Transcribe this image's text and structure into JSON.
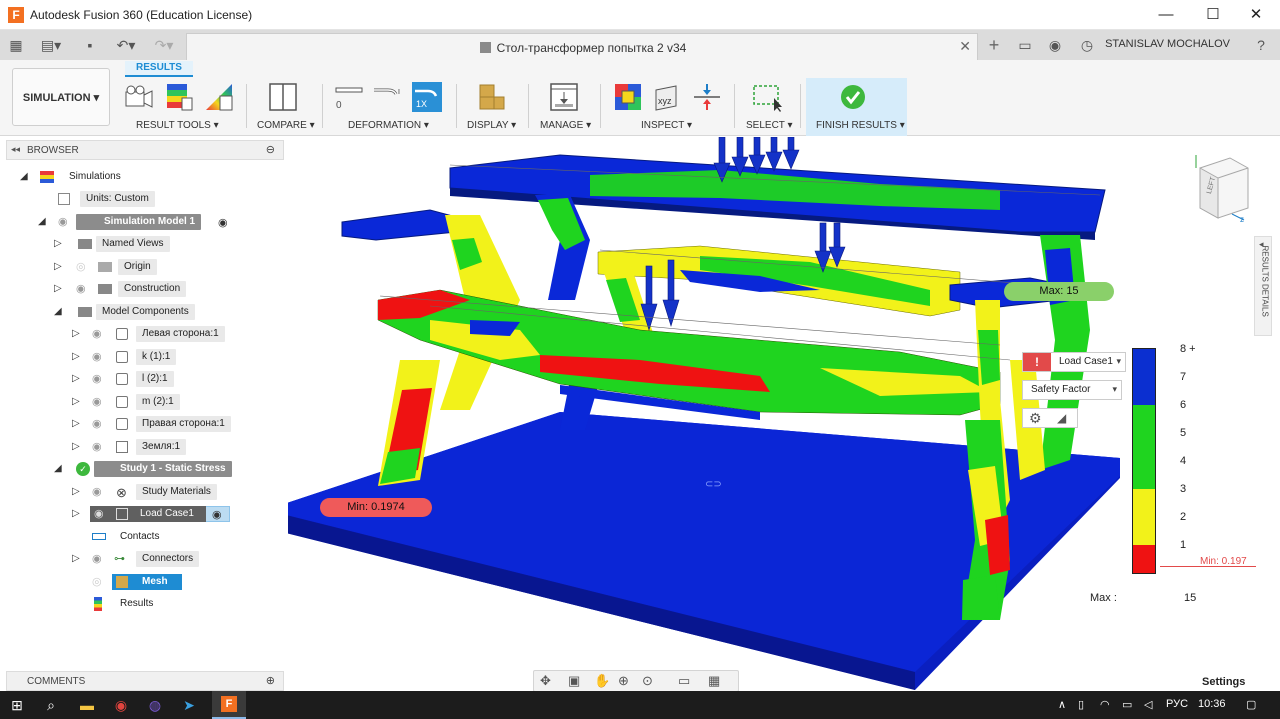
{
  "window": {
    "title": "Autodesk Fusion 360 (Education License)",
    "logo": "F",
    "minimize_glyph": "—",
    "maximize_glyph": "☐",
    "close_glyph": "✕"
  },
  "document": {
    "tab_title": "Стол-трансформер попытка 2 v34",
    "close_glyph": "✕"
  },
  "user": {
    "name": "STANISLAV MOCHALOV"
  },
  "ribbon": {
    "workspace": "SIMULATION ▾",
    "active_tab": "RESULTS",
    "groups": [
      {
        "label": "RESULT TOOLS ▾"
      },
      {
        "label": "COMPARE ▾"
      },
      {
        "label": "DEFORMATION ▾"
      },
      {
        "label": "DISPLAY ▾"
      },
      {
        "label": "MANAGE ▾"
      },
      {
        "label": "INSPECT ▾"
      },
      {
        "label": "SELECT ▾"
      },
      {
        "label": "FINISH RESULTS ▾"
      }
    ],
    "deformation_zero": "0",
    "deformation_1x": "1X",
    "inspect_xyz": "xyz"
  },
  "browser": {
    "title": "BROWSER",
    "items": [
      {
        "label": "Simulations"
      },
      {
        "label": "Units: Custom"
      },
      {
        "label": "Simulation Model 1"
      },
      {
        "label": "Named Views"
      },
      {
        "label": "Origin"
      },
      {
        "label": "Construction"
      },
      {
        "label": "Model Components"
      },
      {
        "label": "Левая сторона:1"
      },
      {
        "label": "k (1):1"
      },
      {
        "label": "l (2):1"
      },
      {
        "label": "m (2):1"
      },
      {
        "label": "Правая сторона:1"
      },
      {
        "label": "Земля:1"
      },
      {
        "label": "Study 1 - Static Stress"
      },
      {
        "label": "Study Materials"
      },
      {
        "label": "Load Case1"
      },
      {
        "label": "Contacts"
      },
      {
        "label": "Connectors"
      },
      {
        "label": "Mesh"
      },
      {
        "label": "Results"
      }
    ]
  },
  "comments": {
    "title": "COMMENTS"
  },
  "viewport": {
    "min_badge": "Min: 0.1974",
    "max_badge": "Max: 15",
    "results_details": "RESULTS DETAILS",
    "load_case_select": "Load Case1",
    "result_type_select": "Safety Factor",
    "legend_ticks": [
      "8 +",
      "7",
      "6",
      "5",
      "4",
      "3",
      "2",
      "1"
    ],
    "legend_min": "Min: 0.197",
    "legend_colors": [
      "#0b2fd0",
      "#1fd41f",
      "#f2f21a",
      "#ef1212"
    ],
    "max_label": "Max :",
    "max_value": "15",
    "settings": "Settings",
    "viewcube_face": "LEFT"
  },
  "taskbar": {
    "language": "РУС",
    "time": "10:36"
  }
}
